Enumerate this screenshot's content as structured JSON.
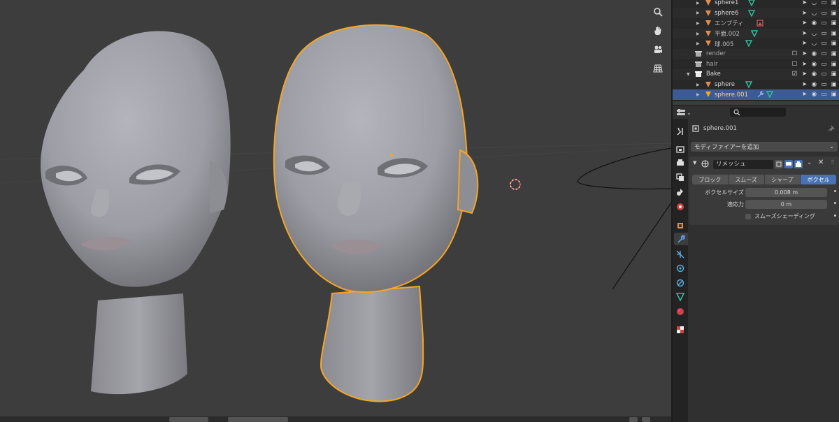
{
  "outliner": {
    "rows": [
      {
        "name": "sphere1",
        "type": "mesh",
        "indent": 2,
        "modifier": "mesh-green"
      },
      {
        "name": "sphere6",
        "type": "mesh",
        "indent": 2,
        "modifier": "mesh-green"
      },
      {
        "name": "エンプティ",
        "type": "mesh",
        "indent": 2,
        "modifier": "image-red"
      },
      {
        "name": "平面.002",
        "type": "mesh",
        "indent": 2,
        "modifier": "mesh-green"
      },
      {
        "name": "球.005",
        "type": "mesh",
        "indent": 2,
        "modifier": "mesh-green"
      },
      {
        "name": "render",
        "type": "collection",
        "indent": 1,
        "modifier": ""
      },
      {
        "name": "hair",
        "type": "collection",
        "indent": 1,
        "modifier": ""
      },
      {
        "name": "Bake",
        "type": "collection",
        "indent": 1,
        "modifier": ""
      },
      {
        "name": "sphere",
        "type": "mesh",
        "indent": 2,
        "modifier": "mesh-green"
      },
      {
        "name": "sphere.001",
        "type": "mesh",
        "indent": 2,
        "modifier": "wrench+mesh",
        "selected": true
      }
    ]
  },
  "properties": {
    "object_name": "sphere.001",
    "add_modifier": "モディファイアーを追加",
    "modifier": {
      "name": "リメッシュ",
      "modes": [
        "ブロック",
        "スムーズ",
        "シャープ",
        "ボクセル"
      ],
      "active_mode": "ボクセル",
      "voxel_size_label": "ボクセルサイズ",
      "voxel_size_value": "0.008 m",
      "adaptivity_label": "適応力",
      "adaptivity_value": "0 m",
      "smooth_shading_label": "スムーズシェーディング"
    }
  },
  "colors": {
    "selection_outline": "#f5a623",
    "outliner_selected": "#3c5a94",
    "mode_active": "#4772b3"
  }
}
